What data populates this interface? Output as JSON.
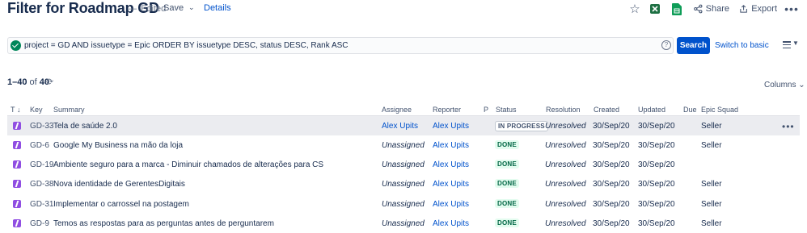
{
  "header": {
    "title": "Filter for Roadmap GD",
    "edited_dash": "—",
    "edited": "Edited",
    "save": "Save",
    "save_chevron": "⌄",
    "details": "Details",
    "share": "Share",
    "export": "Export",
    "icons": [
      "star-icon",
      "excel-icon",
      "google-sheets-icon",
      "share-icon",
      "export-icon",
      "more-icon"
    ]
  },
  "search": {
    "query": "project = GD AND issuetype = Epic ORDER BY issuetype DESC, status DESC, Rank ASC",
    "help": "?",
    "button": "Search",
    "switch": "Switch to basic"
  },
  "results": {
    "range": "1–40",
    "of": " of ",
    "total": "40",
    "columns_button": "Columns ⌄"
  },
  "table": {
    "headers": {
      "type": "T",
      "sort_arrow": "↓",
      "key": "Key",
      "summary": "Summary",
      "assignee": "Assignee",
      "reporter": "Reporter",
      "priority": "P",
      "status": "Status",
      "resolution": "Resolution",
      "created": "Created",
      "updated": "Updated",
      "due": "Due",
      "epic_squad": "Epic Squad"
    },
    "rows": [
      {
        "key": "GD-33",
        "summary": "Tela de saúde 2.0",
        "assignee": "Alex Upits",
        "reporter": "Alex Upits",
        "status": "IN PROGRESS",
        "resolution": "Unresolved",
        "created": "30/Sep/20",
        "updated": "30/Sep/20",
        "due": "",
        "epic_squad": "Seller",
        "more": "•••"
      },
      {
        "key": "GD-6",
        "summary": "Google My Business na mão da loja",
        "assignee": "Unassigned",
        "reporter": "Alex Upits",
        "status": "DONE",
        "resolution": "Unresolved",
        "created": "30/Sep/20",
        "updated": "30/Sep/20",
        "due": "",
        "epic_squad": "Seller"
      },
      {
        "key": "GD-19",
        "summary": "Ambiente seguro para a marca - Diminuir chamados de alterações para CS",
        "assignee": "Unassigned",
        "reporter": "Alex Upits",
        "status": "DONE",
        "resolution": "Unresolved",
        "created": "30/Sep/20",
        "updated": "30/Sep/20",
        "due": "",
        "epic_squad": ""
      },
      {
        "key": "GD-38",
        "summary": "Nova identidade de GerentesDigitais",
        "assignee": "Unassigned",
        "reporter": "Alex Upits",
        "status": "DONE",
        "resolution": "Unresolved",
        "created": "30/Sep/20",
        "updated": "30/Sep/20",
        "due": "",
        "epic_squad": "Seller"
      },
      {
        "key": "GD-31",
        "summary": "Implementar o carrossel na postagem",
        "assignee": "Unassigned",
        "reporter": "Alex Upits",
        "status": "DONE",
        "resolution": "Unresolved",
        "created": "30/Sep/20",
        "updated": "30/Sep/20",
        "due": "",
        "epic_squad": "Seller"
      },
      {
        "key": "GD-9",
        "summary": "Temos as respostas para as perguntas antes de perguntarem",
        "assignee": "Unassigned",
        "reporter": "Alex Upits",
        "status": "DONE",
        "resolution": "Unresolved",
        "created": "30/Sep/20",
        "updated": "30/Sep/20",
        "due": "",
        "epic_squad": "Seller"
      }
    ]
  },
  "colors": {
    "accent": "#0052cc",
    "epic": "#904ee2",
    "done_bg": "#e3fcef",
    "done_text": "#006644",
    "check": "#00875a",
    "excel": "#1d6f42",
    "sheets": "#0f9d58"
  }
}
